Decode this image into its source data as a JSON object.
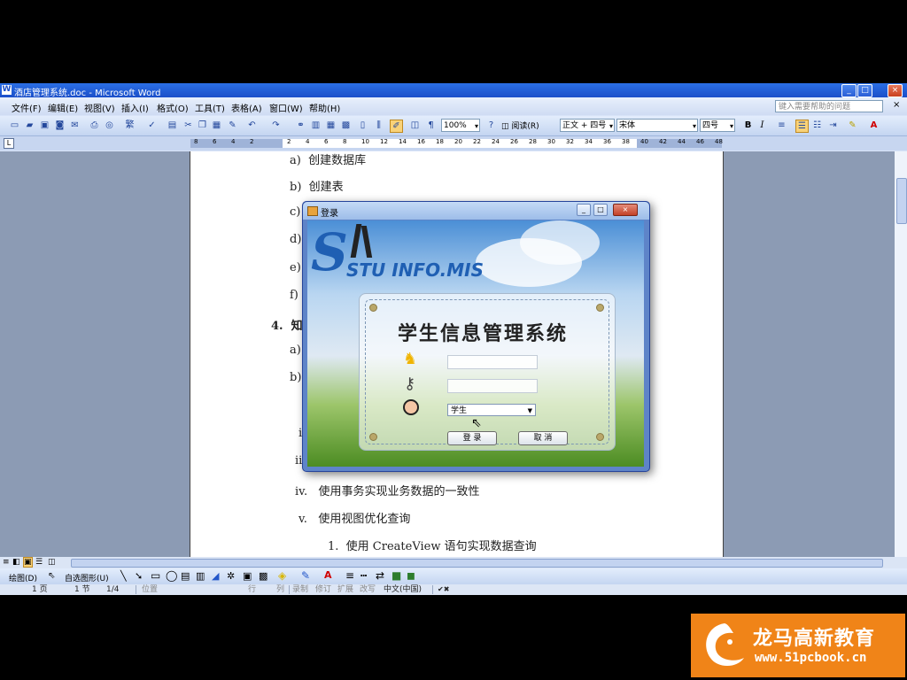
{
  "window": {
    "title": "酒店管理系统.doc - Microsoft Word",
    "min": "_",
    "max": "□",
    "close": "×"
  },
  "menu": {
    "items": [
      "文件(F)",
      "编辑(E)",
      "视图(V)",
      "插入(I)",
      "格式(O)",
      "工具(T)",
      "表格(A)",
      "窗口(W)",
      "帮助(H)"
    ],
    "help_placeholder": "键入需要帮助的问题"
  },
  "toolbar": {
    "zoom": "100%",
    "read_button": "阅读(R)",
    "style": "正文 + 四号",
    "font": "宋体",
    "size": "四号",
    "bold": "B",
    "italic": "I"
  },
  "ruler": {
    "numbers": [
      "8",
      "6",
      "4",
      "2",
      "",
      "2",
      "4",
      "6",
      "8",
      "10",
      "12",
      "14",
      "16",
      "18",
      "20",
      "22",
      "24",
      "26",
      "28",
      "30",
      "32",
      "34",
      "36",
      "38",
      "40",
      "42",
      "44",
      "46",
      "48"
    ]
  },
  "document": {
    "lines": [
      {
        "marker": "a)",
        "text": "创建数据库"
      },
      {
        "marker": "b)",
        "text": "创建表"
      },
      {
        "marker": "c)",
        "text": ""
      },
      {
        "marker": "d)",
        "text": ""
      },
      {
        "marker": "e)",
        "text": ""
      },
      {
        "marker": "f)",
        "text": ""
      },
      {
        "marker": "4.",
        "text": "知"
      },
      {
        "marker": "a)",
        "text": ""
      },
      {
        "marker": "b)",
        "text": ""
      },
      {
        "marker": "i",
        "text": ""
      },
      {
        "marker": "ii",
        "text": ""
      },
      {
        "marker": "iv.",
        "text": "使用事务实现业务数据的一致性"
      },
      {
        "marker": "v.",
        "text": "使用视图优化查询"
      },
      {
        "marker": "1.",
        "text": "使用 CreateView 语句实现数据查询"
      }
    ]
  },
  "drawbar": {
    "draw": "绘图(D)",
    "autoshapes": "自选图形(U)"
  },
  "status": {
    "page": "1 页",
    "section": "1 节",
    "pages": "1/4",
    "pos": "位置",
    "row": "行",
    "col": "列",
    "rec": "录制",
    "trk": "修订",
    "ext": "扩展",
    "ovr": "改写",
    "lang": "中文(中国)"
  },
  "dialog": {
    "title": "登录",
    "logo": "STU INFO.MIS",
    "system_title": "学生信息管理系统",
    "username_value": "",
    "password_value": "",
    "role_selected": "学生",
    "login_button": "登 录",
    "cancel_button": "取 消"
  },
  "watermark": {
    "title": "龙马高新教育",
    "url": "www.51pcbook.cn"
  }
}
